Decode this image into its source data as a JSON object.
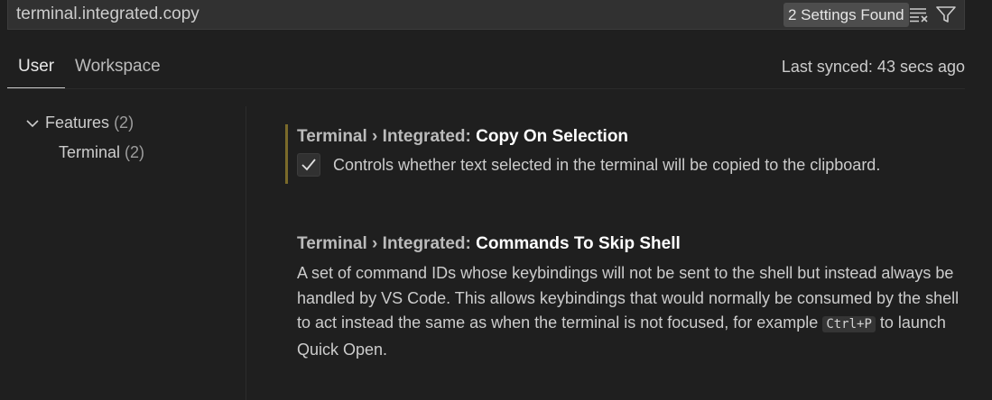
{
  "search": {
    "value": "terminal.integrated.copy",
    "results_badge": "2 Settings Found",
    "clear_icon": "clear-filter-icon",
    "filter_icon": "filter-icon"
  },
  "tabs": [
    {
      "label": "User",
      "active": true
    },
    {
      "label": "Workspace",
      "active": false
    }
  ],
  "last_synced": "Last synced: 43 secs ago",
  "toc": {
    "features": {
      "label": "Features",
      "count": "(2)",
      "expanded": true
    },
    "terminal": {
      "label": "Terminal",
      "count": "(2)"
    }
  },
  "settings": [
    {
      "category": "Terminal › Integrated: ",
      "name": "Copy On Selection",
      "checked": true,
      "description": "Controls whether text selected in the terminal will be copied to the clipboard."
    },
    {
      "category": "Terminal › Integrated: ",
      "name": "Commands To Skip Shell",
      "description_before": "A set of command IDs whose keybindings will not be sent to the shell but instead always be handled by VS Code. This allows keybindings that would normally be consumed by the shell to act instead the same as when the terminal is not focused, for example ",
      "keybinding": "Ctrl+P",
      "description_after": " to launch Quick Open."
    }
  ],
  "colors": {
    "background": "#1f1f1f",
    "focus_bar": "#7a6a2a",
    "badge": "#4d4d4d"
  }
}
